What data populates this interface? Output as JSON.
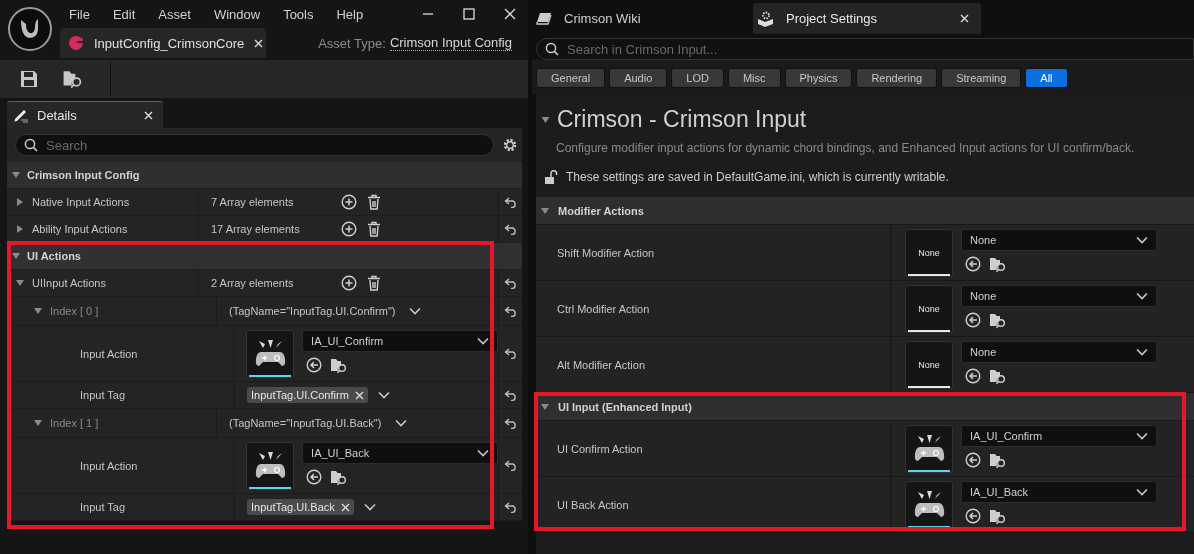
{
  "left": {
    "menu": [
      "File",
      "Edit",
      "Asset",
      "Window",
      "Tools",
      "Help"
    ],
    "asset_tab": {
      "label": "InputConfig_CrimsonCore"
    },
    "asset_type": {
      "label": "Asset Type:",
      "value": "Crimson Input Config"
    },
    "details_tab": "Details",
    "search": {
      "placeholder": "Search"
    },
    "categories": [
      {
        "name": "Crimson Input Config",
        "expanded": true,
        "highlighted": false,
        "rows": [
          {
            "kind": "array",
            "name": "Native Input Actions",
            "expanded": false,
            "value": "7 Array elements"
          },
          {
            "kind": "array",
            "name": "Ability Input Actions",
            "expanded": false,
            "value": "17 Array elements"
          }
        ]
      },
      {
        "name": "UI Actions",
        "expanded": true,
        "highlighted": true,
        "rows": [
          {
            "kind": "array",
            "name": "UIInput Actions",
            "expanded": true,
            "value": "2 Array elements",
            "children": [
              {
                "kind": "struct",
                "name": "Index [ 0 ]",
                "expanded": true,
                "value": "(TagName=\"InputTag.UI.Confirm\")",
                "children": [
                  {
                    "kind": "asset",
                    "name": "Input Action",
                    "asset": "IA_UI_Confirm"
                  },
                  {
                    "kind": "tag",
                    "name": "Input Tag",
                    "tag": "InputTag.UI.Confirm"
                  }
                ]
              },
              {
                "kind": "struct",
                "name": "Index [ 1 ]",
                "expanded": true,
                "value": "(TagName=\"InputTag.UI.Back\")",
                "children": [
                  {
                    "kind": "asset",
                    "name": "Input Action",
                    "asset": "IA_UI_Back"
                  },
                  {
                    "kind": "tag",
                    "name": "Input Tag",
                    "tag": "InputTag.UI.Back"
                  }
                ]
              }
            ]
          }
        ]
      }
    ]
  },
  "right": {
    "tabs": [
      {
        "label": "Crimson Wiki",
        "selected": false
      },
      {
        "label": "Project Settings",
        "selected": true
      }
    ],
    "search": {
      "placeholder": "Search in Crimson Input..."
    },
    "filters": [
      {
        "label": "General",
        "selected": false
      },
      {
        "label": "Audio",
        "selected": false
      },
      {
        "label": "LOD",
        "selected": false
      },
      {
        "label": "Misc",
        "selected": false
      },
      {
        "label": "Physics",
        "selected": false
      },
      {
        "label": "Rendering",
        "selected": false
      },
      {
        "label": "Streaming",
        "selected": false
      },
      {
        "label": "All",
        "selected": true
      }
    ],
    "title": "Crimson - Crimson Input",
    "description": "Configure modifier input actions for dynamic chord bindings, and Enhanced Input actions for UI confirm/back.",
    "config_note": "These settings are saved in DefaultGame.ini, which is currently writable.",
    "categories": [
      {
        "name": "Modifier Actions",
        "expanded": true,
        "highlighted": false,
        "rows": [
          {
            "name": "Shift Modifier Action",
            "asset": "None",
            "thumbnail_label": "None"
          },
          {
            "name": "Ctrl Modifier Action",
            "asset": "None",
            "thumbnail_label": "None"
          },
          {
            "name": "Alt Modifier Action",
            "asset": "None",
            "thumbnail_label": "None"
          }
        ]
      },
      {
        "name": "UI Input (Enhanced Input)",
        "expanded": true,
        "highlighted": true,
        "rows": [
          {
            "name": "UI Confirm Action",
            "asset": "IA_UI_Confirm"
          },
          {
            "name": "UI Back Action",
            "asset": "IA_UI_Back"
          }
        ]
      }
    ]
  }
}
